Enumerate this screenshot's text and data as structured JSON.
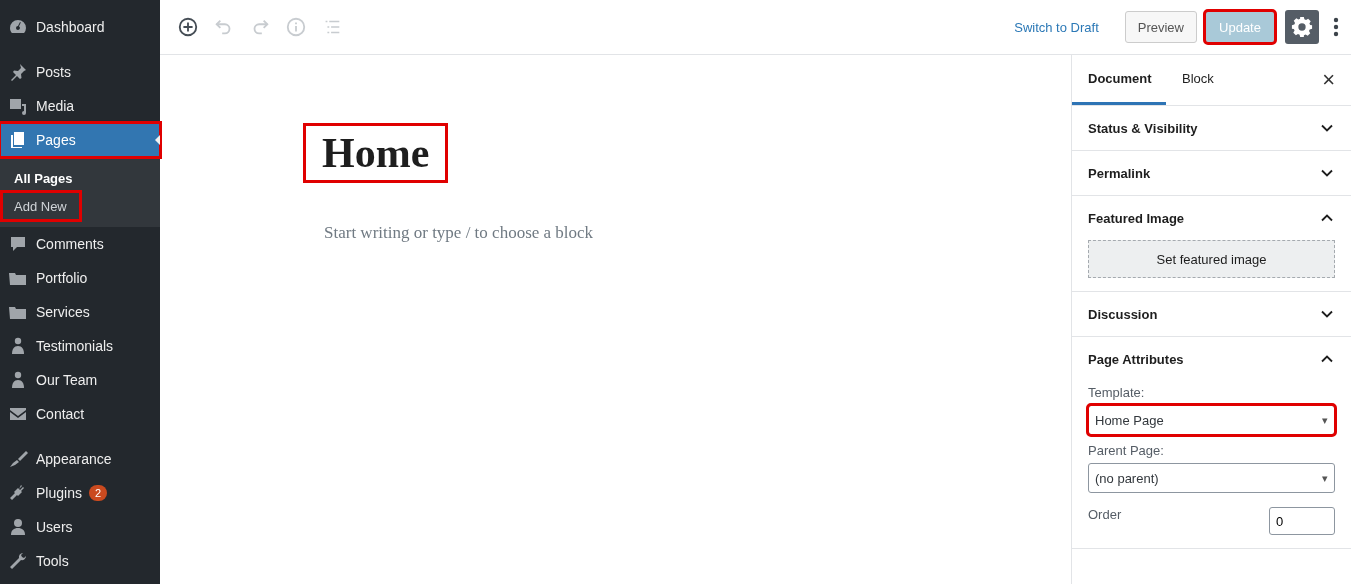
{
  "sidebar": {
    "groups": [
      {
        "items": [
          {
            "label": "Dashboard",
            "selected": false,
            "highlighted": false
          }
        ]
      },
      {
        "items": [
          {
            "label": "Posts",
            "selected": false,
            "highlighted": false
          },
          {
            "label": "Media",
            "selected": false,
            "highlighted": false
          },
          {
            "label": "Pages",
            "selected": true,
            "highlighted": true,
            "children": [
              {
                "label": "All Pages",
                "selected": true,
                "highlighted": false
              },
              {
                "label": "Add New",
                "selected": false,
                "highlighted": true
              }
            ]
          },
          {
            "label": "Comments",
            "selected": false,
            "highlighted": false
          },
          {
            "label": "Portfolio",
            "selected": false,
            "highlighted": false
          },
          {
            "label": "Services",
            "selected": false,
            "highlighted": false
          },
          {
            "label": "Testimonials",
            "selected": false,
            "highlighted": false
          },
          {
            "label": "Our Team",
            "selected": false,
            "highlighted": false
          },
          {
            "label": "Contact",
            "selected": false,
            "highlighted": false
          }
        ]
      },
      {
        "items": [
          {
            "label": "Appearance",
            "selected": false,
            "highlighted": false
          },
          {
            "label": "Plugins",
            "selected": false,
            "highlighted": false,
            "badge": "2"
          },
          {
            "label": "Users",
            "selected": false,
            "highlighted": false
          },
          {
            "label": "Tools",
            "selected": false,
            "highlighted": false
          }
        ]
      }
    ]
  },
  "toolbar": {
    "tools": [
      {
        "disabled": false
      },
      {
        "disabled": true
      },
      {
        "disabled": true
      },
      {
        "disabled": true
      },
      {
        "disabled": true
      }
    ],
    "switch_link": "Switch to Draft",
    "preview_button": "Preview",
    "update_button": {
      "label": "Update",
      "disabled": true,
      "highlighted": true
    },
    "settings_active": true
  },
  "editor": {
    "title": "Home",
    "title_highlighted": true,
    "placeholder": "Start writing or type / to choose a block"
  },
  "panel": {
    "tabs": [
      {
        "label": "Document",
        "selected": true
      },
      {
        "label": "Block",
        "selected": false
      }
    ],
    "close": "×",
    "sections": [
      {
        "title": "Status & Visibility",
        "expanded": false
      },
      {
        "title": "Permalink",
        "expanded": false
      },
      {
        "title": "Featured Image",
        "expanded": true,
        "kind": "featured",
        "button": "Set featured image"
      },
      {
        "title": "Discussion",
        "expanded": false
      },
      {
        "title": "Page Attributes",
        "expanded": true,
        "kind": "attributes",
        "template": {
          "label": "Template:",
          "value": "Home Page",
          "caret": "▾",
          "highlighted": true
        },
        "parent": {
          "label": "Parent Page:",
          "value": "(no parent)",
          "caret": "▾",
          "highlighted": false
        },
        "order": {
          "label": "Order",
          "value": "0"
        }
      }
    ]
  }
}
